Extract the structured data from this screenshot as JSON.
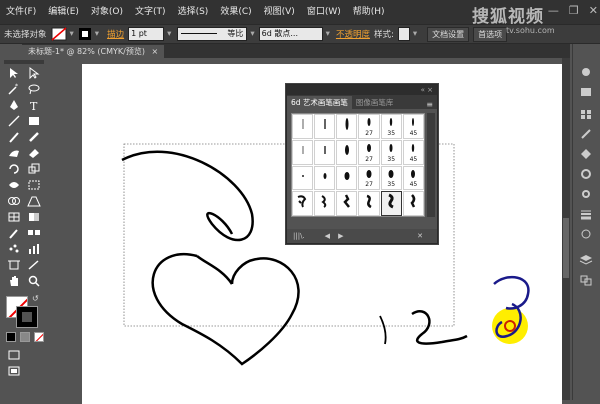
{
  "menu": {
    "items": [
      "文件(F)",
      "编辑(E)",
      "对象(O)",
      "文字(T)",
      "选择(S)",
      "效果(C)",
      "视图(V)",
      "窗口(W)",
      "帮助(H)"
    ]
  },
  "watermark": {
    "brand": "搜狐视频",
    "url": "tv.sohu.com"
  },
  "control_bar": {
    "selection_label": "未选择对象",
    "stroke_label": "描边",
    "stroke_value": "1 pt",
    "profile_label": "等比",
    "brush_label": "6d 散点...",
    "opacity_label": "不透明度",
    "style_label": "样式:",
    "doc_setup": "文档设置",
    "prefs": "首选项"
  },
  "document_tab": {
    "label": "未标题-1* @ 82% (CMYK/预览)",
    "close": "×"
  },
  "panel": {
    "header_glyph": "«  ×",
    "tabs": [
      {
        "label": "6d 艺术画笔画笔",
        "active": true
      },
      {
        "label": "图像画笔库",
        "active": false
      }
    ],
    "menu_glyph": "≡",
    "cells": [
      {
        "label": ""
      },
      {
        "label": ""
      },
      {
        "label": ""
      },
      {
        "label": "27"
      },
      {
        "label": "35"
      },
      {
        "label": "45"
      },
      {
        "label": ""
      },
      {
        "label": ""
      },
      {
        "label": ""
      },
      {
        "label": "27"
      },
      {
        "label": "35"
      },
      {
        "label": "45"
      },
      {
        "label": ""
      },
      {
        "label": ""
      },
      {
        "label": ""
      },
      {
        "label": "27"
      },
      {
        "label": "35"
      },
      {
        "label": "45"
      },
      {
        "label": ""
      },
      {
        "label": ""
      },
      {
        "label": ""
      },
      {
        "label": ""
      },
      {
        "label": ""
      },
      {
        "label": ""
      }
    ],
    "footer": [
      "|||\\.",
      "◀",
      "▶",
      "✕"
    ]
  },
  "colors": {
    "accent": "#f0a030",
    "highlight": "#ffee00",
    "cursor": "#cc2200"
  }
}
